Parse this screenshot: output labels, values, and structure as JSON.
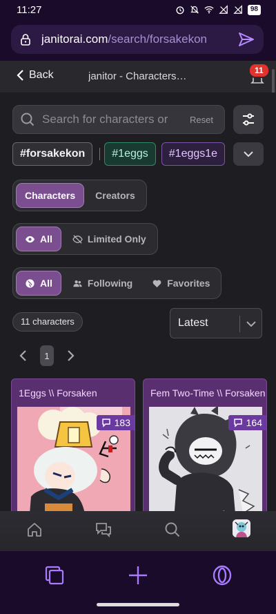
{
  "status_bar": {
    "time": "11:27",
    "battery": "98"
  },
  "browser": {
    "url_host": "janitorai.com",
    "url_path": "/search/forsakekon"
  },
  "header": {
    "back_label": "Back",
    "title": "janitor - Characters…",
    "notification_count": "11"
  },
  "search": {
    "placeholder": "Search for characters or",
    "reset_label": "Reset"
  },
  "tags": [
    "#forsakekon",
    "#1eggs",
    "#1eggs1e"
  ],
  "type_toggle": {
    "options": [
      "Characters",
      "Creators"
    ],
    "selected": "Characters"
  },
  "limit_toggle": {
    "options": [
      "All",
      "Limited Only"
    ],
    "selected": "All"
  },
  "scope_toggle": {
    "options": [
      "All",
      "Following",
      "Favorites"
    ],
    "selected": "All"
  },
  "results": {
    "count_label": "11 characters"
  },
  "sort": {
    "selected": "Latest"
  },
  "pagination": {
    "current": "1"
  },
  "cards": [
    {
      "title": "1Eggs \\\\ Forsaken",
      "message_count": "183"
    },
    {
      "title": "Fem Two-Time \\\\ Forsaken",
      "message_count": "164"
    }
  ],
  "colors": {
    "accent": "#7b4e90",
    "browser_bg": "#1a0b2a",
    "card_bg": "#5a2f70",
    "badge_red": "#e0332f"
  }
}
